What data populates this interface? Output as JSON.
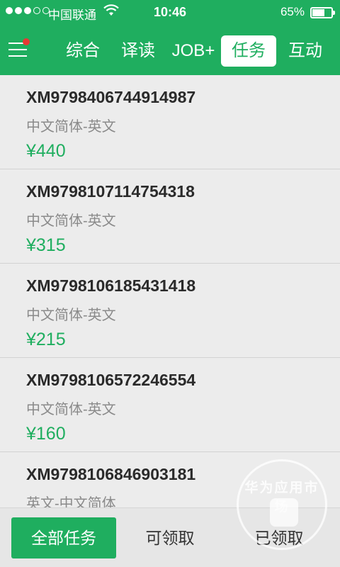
{
  "status_bar": {
    "carrier": "中国联通",
    "time": "10:46",
    "battery": "65%",
    "battery_level": 0.65
  },
  "nav": {
    "tabs": [
      {
        "label": "综合",
        "active": false
      },
      {
        "label": "译读",
        "active": false
      },
      {
        "label": "JOB+",
        "active": false
      },
      {
        "label": "任务",
        "active": true
      },
      {
        "label": "互动",
        "active": false
      }
    ]
  },
  "tasks": [
    {
      "code": "XM9798406744914987",
      "lang": "中文简体-英文",
      "price": "¥440"
    },
    {
      "code": "XM9798107114754318",
      "lang": "中文简体-英文",
      "price": "¥315"
    },
    {
      "code": "XM9798106185431418",
      "lang": "中文简体-英文",
      "price": "¥215"
    },
    {
      "code": "XM9798106572246554",
      "lang": "中文简体-英文",
      "price": "¥160"
    },
    {
      "code": "XM9798106846903181",
      "lang": "英文-中文简体",
      "price": ""
    }
  ],
  "bottom": {
    "all_tasks": "全部任务",
    "available": "可领取",
    "claimed": "已领取"
  },
  "watermark": {
    "text": "华为应用市场"
  },
  "colors": {
    "brand": "#1fae5f",
    "notification": "#e53935"
  }
}
